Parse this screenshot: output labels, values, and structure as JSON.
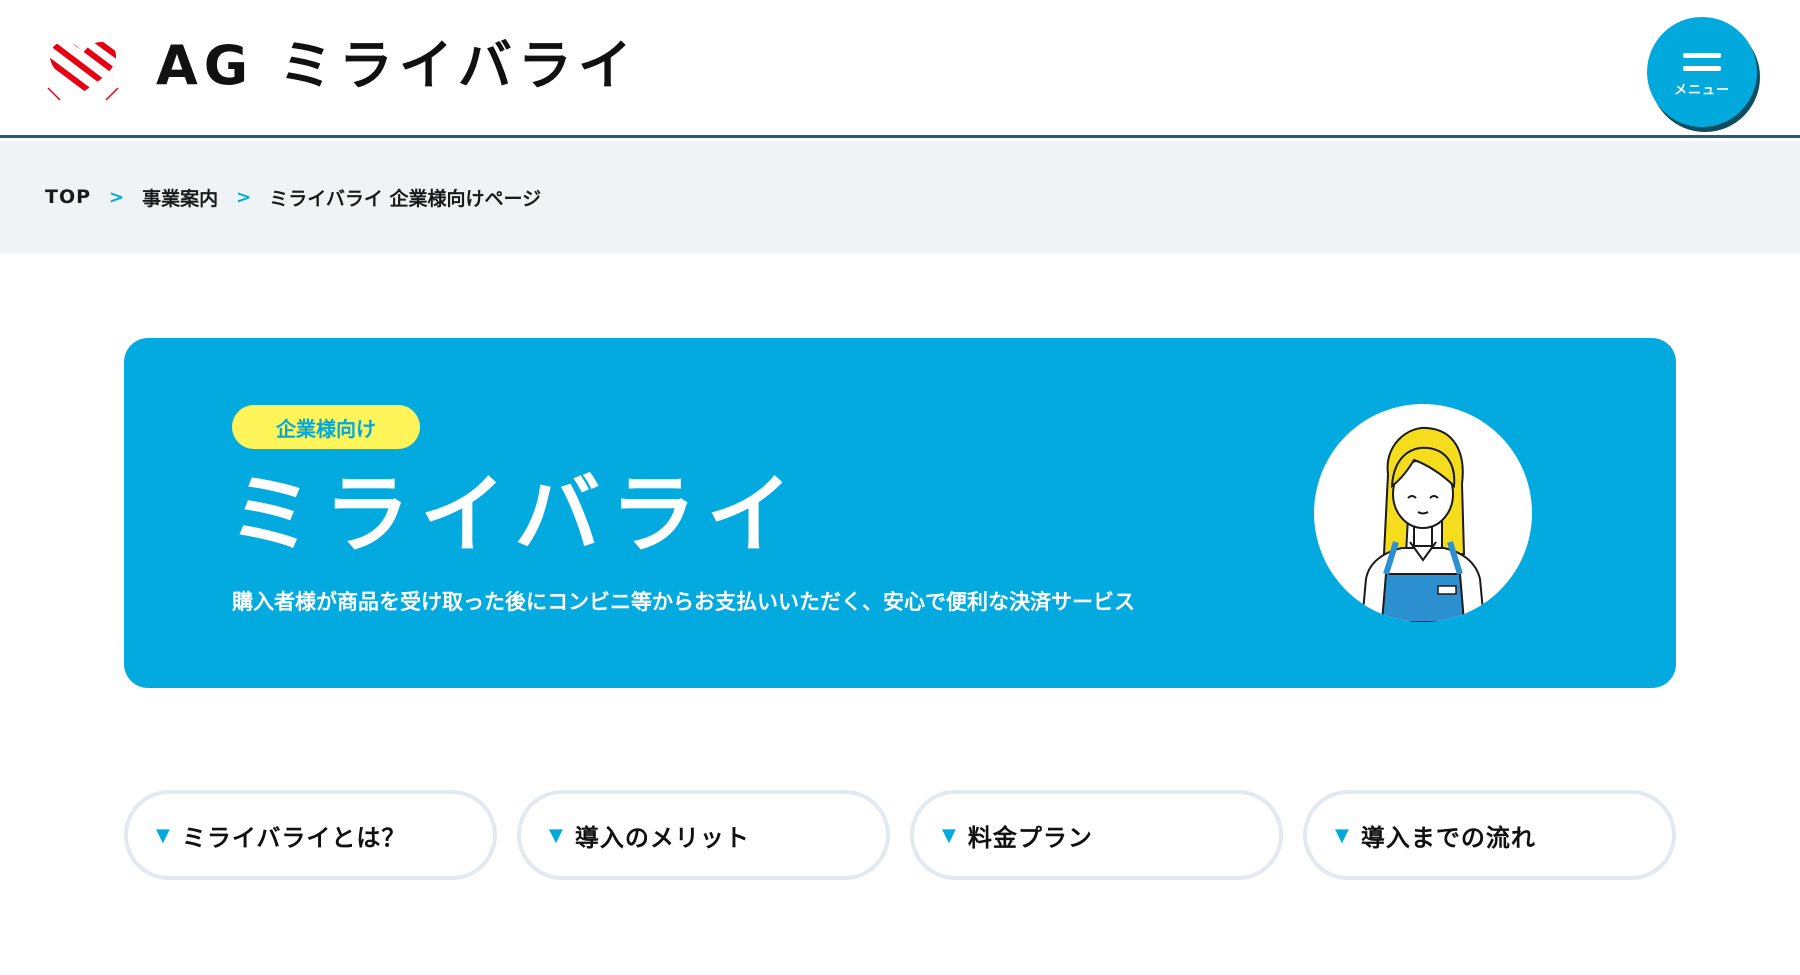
{
  "header": {
    "logo_text": "AG ミライバライ",
    "menu_label": "メニュー"
  },
  "breadcrumb": {
    "items": [
      "TOP",
      "事業案内",
      "ミライバライ 企業様向けページ"
    ]
  },
  "hero": {
    "badge": "企業様向け",
    "title": "ミライバライ",
    "description": "購入者様が商品を受け取った後にコンビニ等からお支払いいただく、安心で便利な決済サービス"
  },
  "anchor_nav": {
    "items": [
      {
        "label": "ミライバライとは？"
      },
      {
        "label": "導入のメリット"
      },
      {
        "label": "料金プラン"
      },
      {
        "label": "導入までの流れ"
      }
    ]
  },
  "colors": {
    "accent": "#02aadf",
    "badge_bg": "#fff45a",
    "logo_red": "#e60012",
    "header_border": "#1f5f6e"
  }
}
